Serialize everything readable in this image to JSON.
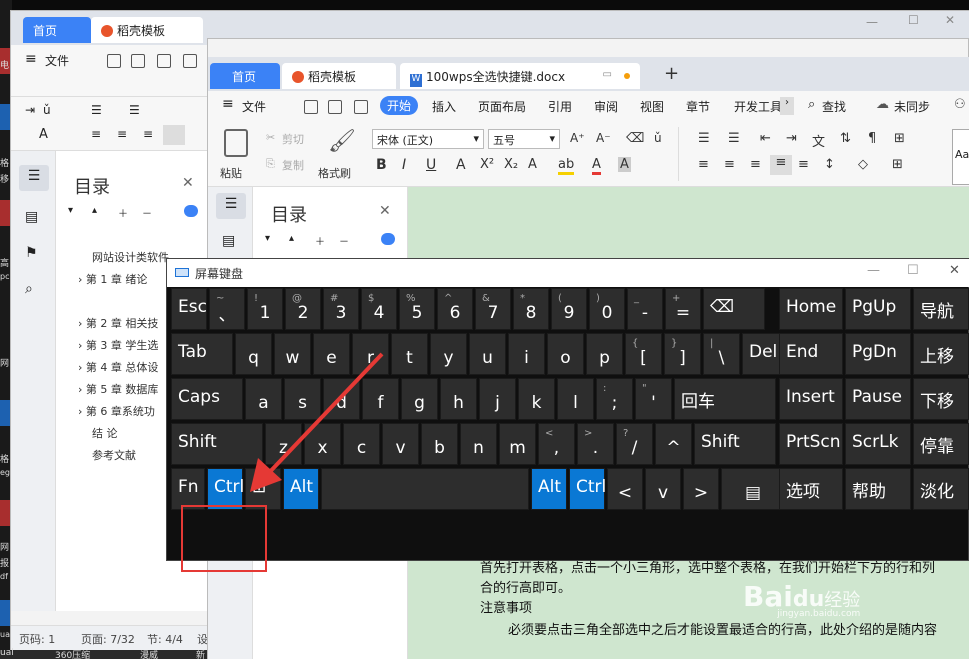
{
  "desktop": {
    "labels": [
      "电",
      "格",
      "移",
      "高",
      "pc",
      "网",
      "格",
      "eg",
      "网",
      "报",
      "df",
      "ual"
    ]
  },
  "back_window": {
    "tabs": [
      "首页",
      "稻壳模板"
    ],
    "file_menu": "文件",
    "toc_title": "目录",
    "toc_items": [
      "网站设计类软件...",
      "第 1 章  绪论",
      "第 2 章  相关技",
      "第 3 章  学生选",
      "第 4 章  总体设",
      "第 5 章  数据库",
      "第 6 章系统功",
      "结    论",
      "参考文献"
    ],
    "status": [
      "页码: 1",
      "页面: 7/32",
      "节: 4/4",
      "设"
    ]
  },
  "taskbar": [
    "ual",
    "360压缩",
    "漫威",
    "新"
  ],
  "front_window": {
    "tabs": {
      "home": "首页",
      "template": "稻壳模板",
      "doc": "100wps全选快捷键.docx"
    },
    "menu": [
      "文件",
      "开始",
      "插入",
      "页面布局",
      "引用",
      "审阅",
      "视图",
      "章节",
      "开发工具"
    ],
    "menu_active": "开始",
    "search": "查找",
    "sync": "未同步",
    "ribbon": {
      "paste": "粘贴",
      "cut": "剪切",
      "copy": "复制",
      "format_painter": "格式刷",
      "font": "宋体 (正文)",
      "size": "五号"
    },
    "toc_title": "目录",
    "doc_lines": [
      "首先打开表格，点击一个小三角形，选中整个表格，在我们开始栏下方的行和列",
      "合的行高即可。",
      "注意事项",
      "必须要点击三角全部选中之后才能设置最适合的行高，此处介绍的是随内容"
    ]
  },
  "keyboard": {
    "title": "屏幕键盘",
    "row1": [
      {
        "main": "Esc"
      },
      {
        "shift": "~",
        "main": "、"
      },
      {
        "shift": "!",
        "main": "1"
      },
      {
        "shift": "@",
        "main": "2"
      },
      {
        "shift": "#",
        "main": "3"
      },
      {
        "shift": "$",
        "main": "4"
      },
      {
        "shift": "%",
        "main": "5"
      },
      {
        "shift": "^",
        "main": "6"
      },
      {
        "shift": "&",
        "main": "7"
      },
      {
        "shift": "*",
        "main": "8"
      },
      {
        "shift": "(",
        "main": "9"
      },
      {
        "shift": ")",
        "main": "0"
      },
      {
        "shift": "_",
        "main": "-"
      },
      {
        "shift": "+",
        "main": "="
      },
      {
        "main": "⌫"
      }
    ],
    "row2": [
      {
        "main": "Tab"
      },
      {
        "main": "q"
      },
      {
        "main": "w"
      },
      {
        "main": "e"
      },
      {
        "main": "r"
      },
      {
        "main": "t"
      },
      {
        "main": "y"
      },
      {
        "main": "u"
      },
      {
        "main": "i"
      },
      {
        "main": "o"
      },
      {
        "main": "p"
      },
      {
        "shift": "{",
        "main": "["
      },
      {
        "shift": "}",
        "main": "]"
      },
      {
        "shift": "|",
        "main": "\\"
      },
      {
        "main": "Del"
      }
    ],
    "row3": [
      {
        "main": "Caps"
      },
      {
        "main": "a"
      },
      {
        "main": "s"
      },
      {
        "main": "d"
      },
      {
        "main": "f"
      },
      {
        "main": "g"
      },
      {
        "main": "h"
      },
      {
        "main": "j"
      },
      {
        "main": "k"
      },
      {
        "main": "l"
      },
      {
        "shift": ":",
        "main": ";"
      },
      {
        "shift": "\"",
        "main": "'"
      },
      {
        "main": "回车"
      }
    ],
    "row4": [
      {
        "main": "Shift"
      },
      {
        "main": "z"
      },
      {
        "main": "x"
      },
      {
        "main": "c"
      },
      {
        "main": "v"
      },
      {
        "main": "b"
      },
      {
        "main": "n"
      },
      {
        "main": "m"
      },
      {
        "shift": "<",
        "main": ","
      },
      {
        "shift": ">",
        "main": "."
      },
      {
        "shift": "?",
        "main": "/"
      },
      {
        "main": "^"
      },
      {
        "main": "Shift"
      }
    ],
    "row5": [
      {
        "main": "Fn"
      },
      {
        "main": "Ctrl"
      },
      {
        "main": "⊞"
      },
      {
        "main": "Alt"
      },
      {
        "main": ""
      },
      {
        "main": "Alt"
      },
      {
        "main": "Ctrl"
      },
      {
        "main": "<"
      },
      {
        "main": "v"
      },
      {
        "main": ">"
      },
      {
        "main": "▤"
      }
    ],
    "nav": [
      [
        "Home",
        "PgUp",
        "导航"
      ],
      [
        "End",
        "PgDn",
        "上移"
      ],
      [
        "Insert",
        "Pause",
        "下移"
      ],
      [
        "PrtScn",
        "ScrLk",
        "停靠"
      ],
      [
        "选项",
        "帮助",
        "淡化"
      ]
    ]
  },
  "watermark": {
    "brand": "Bai",
    "paw": "du",
    "suffix": "经验",
    "url": "jingyan.baidu.com"
  },
  "colors": {
    "key_bg": "#2d2d2d",
    "key_blue": "#0a78d4",
    "accent": "#3b82f6",
    "highlight": "#e53935"
  }
}
